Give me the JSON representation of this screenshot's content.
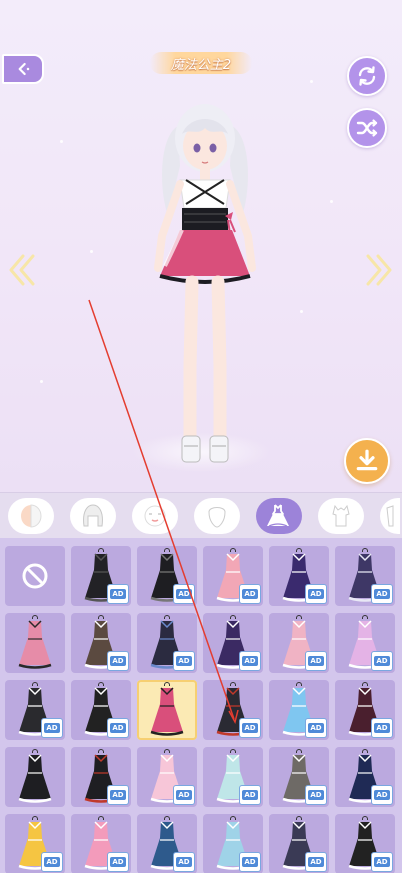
{
  "header": {
    "title": "魔法公主2",
    "back_icon": "back-arrow-icon",
    "rotate_icon": "rotate-icon",
    "shuffle_icon": "shuffle-icon",
    "download_icon": "download-icon"
  },
  "colors": {
    "accent": "#a98adf",
    "download": "#f4b14e",
    "grid_bg": "#d3c6ec",
    "cell_bg": "#bba9df",
    "selected_cell": "#fbeab4"
  },
  "categories": [
    {
      "name": "face",
      "icon": "face-icon",
      "active": false
    },
    {
      "name": "hair",
      "icon": "hair-icon",
      "active": false
    },
    {
      "name": "expression",
      "icon": "expression-icon",
      "active": false
    },
    {
      "name": "head",
      "icon": "head-icon",
      "active": false
    },
    {
      "name": "dress",
      "icon": "dress-icon",
      "active": true
    },
    {
      "name": "top",
      "icon": "top-icon",
      "active": false
    },
    {
      "name": "more",
      "icon": "partial-icon",
      "active": false
    }
  ],
  "outfits": [
    {
      "kind": "none"
    },
    {
      "color": "#222226",
      "trim": "#555",
      "ad": "AD"
    },
    {
      "color": "#1e1e22",
      "trim": "#777",
      "ad": "AD"
    },
    {
      "color": "#f2a7b6",
      "trim": "#fff",
      "ad": "AD"
    },
    {
      "color": "#3a2a6e",
      "trim": "#fff",
      "ad": "AD"
    },
    {
      "color": "#3e3766",
      "trim": "#e8e8f5",
      "ad": "AD"
    },
    {
      "color": "#e68ca8",
      "trim": "#2a2a2a",
      "ad": ""
    },
    {
      "color": "#5b4a40",
      "trim": "#fff",
      "ad": "AD"
    },
    {
      "color": "#2b2b40",
      "trim": "#6b8acc",
      "ad": "AD"
    },
    {
      "color": "#3b2a63",
      "trim": "#fff",
      "ad": "AD"
    },
    {
      "color": "#f0b3c4",
      "trim": "#fff",
      "ad": "AD"
    },
    {
      "color": "#e4b3e6",
      "trim": "#fff",
      "ad": "AD"
    },
    {
      "color": "#2a2a2e",
      "trim": "#fff",
      "ad": "AD"
    },
    {
      "color": "#222",
      "trim": "#fff",
      "ad": "AD"
    },
    {
      "color": "#d94f7b",
      "trim": "#222",
      "ad": "",
      "selected": true
    },
    {
      "color": "#2a2a33",
      "trim": "#c0392b",
      "ad": "AD"
    },
    {
      "color": "#7fc6f0",
      "trim": "#fff",
      "ad": "AD"
    },
    {
      "color": "#4a1f2e",
      "trim": "#fff",
      "ad": "AD"
    },
    {
      "color": "#1e1e22",
      "trim": "#fff",
      "ad": ""
    },
    {
      "color": "#1e1e22",
      "trim": "#c0392b",
      "ad": "AD"
    },
    {
      "color": "#f7c6d8",
      "trim": "#fff",
      "ad": "AD"
    },
    {
      "color": "#bfe6e8",
      "trim": "#fff",
      "ad": "AD"
    },
    {
      "color": "#6e6a66",
      "trim": "#fff",
      "ad": "AD"
    },
    {
      "color": "#1f2a55",
      "trim": "#fff",
      "ad": "AD"
    },
    {
      "color": "#f5c542",
      "trim": "#fff",
      "ad": "AD"
    },
    {
      "color": "#f39bbb",
      "trim": "#fff",
      "ad": "AD"
    },
    {
      "color": "#2e5a8c",
      "trim": "#fff",
      "ad": "AD"
    },
    {
      "color": "#9fd3e8",
      "trim": "#fff",
      "ad": "AD"
    },
    {
      "color": "#3a3a55",
      "trim": "#fff",
      "ad": "AD"
    },
    {
      "color": "#222",
      "trim": "#fff",
      "ad": "AD"
    }
  ]
}
